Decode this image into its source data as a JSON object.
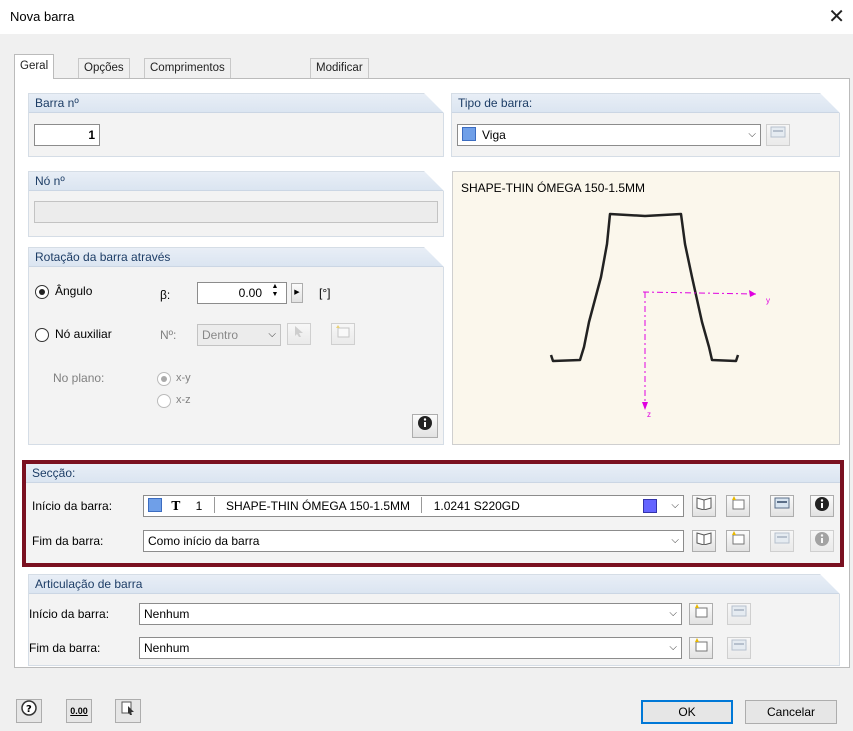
{
  "window": {
    "title": "Nova barra",
    "close_glyph": "✕"
  },
  "tabs": [
    {
      "label": "Geral"
    },
    {
      "label": "Opções"
    },
    {
      "label": "Comprimentos efetivos"
    },
    {
      "label": "Modificar rigidez"
    }
  ],
  "barra_no": {
    "heading": "Barra nº",
    "value": "1"
  },
  "tipo_barra": {
    "heading": "Tipo de barra:",
    "value": "Viga",
    "color": "#6f9fe8"
  },
  "no_no": {
    "heading": "Nó nº",
    "value": ""
  },
  "rotacao": {
    "heading": "Rotação da barra através",
    "angulo_label": "Ângulo",
    "beta_label": "β:",
    "beta_value": "0.00",
    "unit": "[°]",
    "no_aux_label": "Nó auxiliar",
    "n_label": "Nº:",
    "dentro_value": "Dentro",
    "plano_label": "No plano:",
    "xy_label": "x-y",
    "xz_label": "x-z"
  },
  "preview": {
    "title": "SHAPE-THIN ÓMEGA 150-1.5MM",
    "axis_y": "y",
    "axis_z": "z"
  },
  "seccao": {
    "heading": "Secção:",
    "inicio_label": "Início da barra:",
    "inicio_symbol": "T",
    "inicio_number": "1",
    "inicio_section": "SHAPE-THIN ÓMEGA 150-1.5MM",
    "inicio_material": "1.0241 S220GD",
    "fim_label": "Fim da barra:",
    "fim_value": "Como início da barra",
    "highlight_color": "#7a1020"
  },
  "articulacao": {
    "heading": "Articulação de barra",
    "inicio_label": "Início da barra:",
    "inicio_value": "Nenhum",
    "fim_label": "Fim da barra:",
    "fim_value": "Nenhum"
  },
  "footer": {
    "units_label": "0.00",
    "ok_label": "OK",
    "cancel_label": "Cancelar"
  },
  "icons": {
    "info": "info-icon",
    "library": "library-icon",
    "new": "new-icon",
    "edit": "edit-icon",
    "pick": "pick-icon",
    "help": "help-icon"
  }
}
